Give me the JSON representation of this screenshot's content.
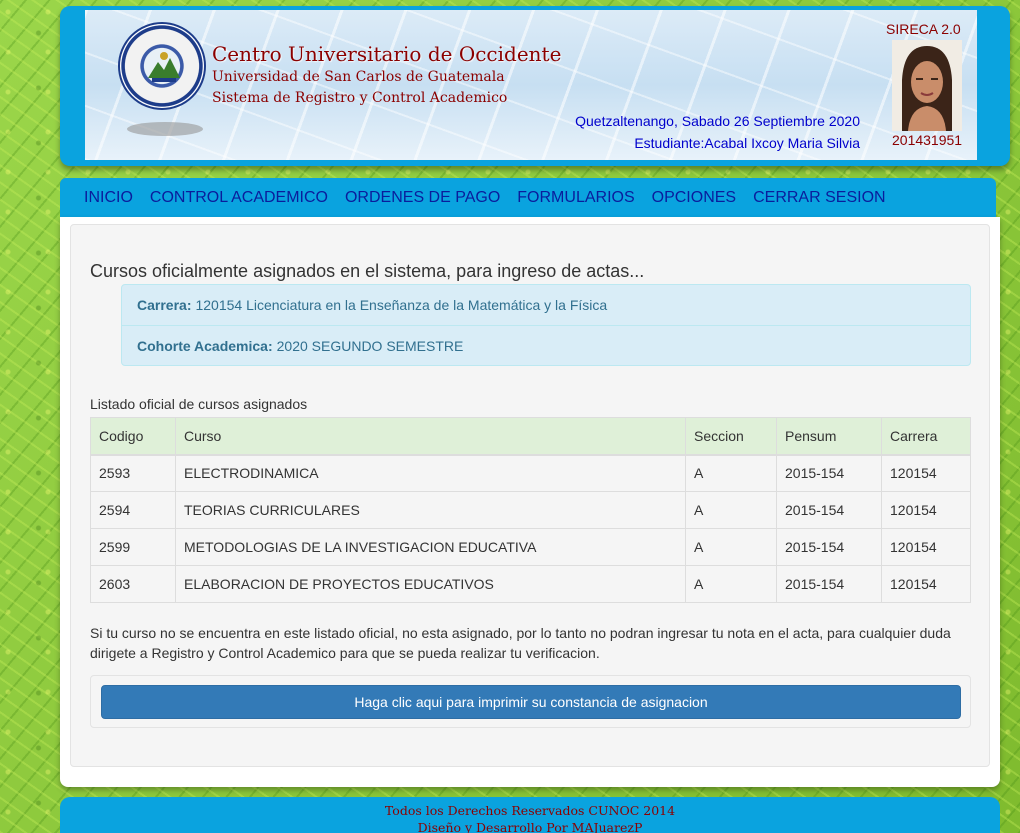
{
  "header": {
    "institution": "Centro Universitario de Occidente",
    "university": "Universidad de San Carlos de Guatemala",
    "system": "Sistema de Registro y Control Academico",
    "date_line": "Quetzaltenango, Sabado 26 Septiembre 2020",
    "student_line": "Estudiante:Acabal Ixcoy Maria Silvia",
    "app_name": "SIRECA 2.0",
    "student_id": "201431951"
  },
  "nav": {
    "items": [
      {
        "label": "INICIO"
      },
      {
        "label": "CONTROL ACADEMICO"
      },
      {
        "label": "ORDENES DE PAGO"
      },
      {
        "label": "FORMULARIOS"
      },
      {
        "label": "OPCIONES"
      },
      {
        "label": "CERRAR SESION"
      }
    ]
  },
  "main": {
    "heading": "Cursos oficialmente asignados en el sistema, para ingreso de actas...",
    "info": {
      "carrera_label": "Carrera:",
      "carrera_value": "120154 Licenciatura en la Enseñanza de la Matemática y la Física",
      "cohorte_label": "Cohorte Academica:",
      "cohorte_value": "2020 SEGUNDO SEMESTRE"
    },
    "list_caption": "Listado oficial de cursos asignados",
    "table": {
      "headers": [
        "Codigo",
        "Curso",
        "Seccion",
        "Pensum",
        "Carrera"
      ],
      "rows": [
        [
          "2593",
          "ELECTRODINAMICA",
          "A",
          "2015-154",
          "120154"
        ],
        [
          "2594",
          "TEORIAS CURRICULARES",
          "A",
          "2015-154",
          "120154"
        ],
        [
          "2599",
          "METODOLOGIAS DE LA INVESTIGACION EDUCATIVA",
          "A",
          "2015-154",
          "120154"
        ],
        [
          "2603",
          "ELABORACION DE PROYECTOS EDUCATIVOS",
          "A",
          "2015-154",
          "120154"
        ]
      ]
    },
    "note": "Si tu curso no se encuentra en este listado oficial, no esta asignado, por lo tanto no podran ingresar tu nota en el acta, para cualquier duda dirigete a Registro y Control Academico para que se pueda realizar tu verificacion.",
    "print_button": "Haga clic aqui para imprimir su constancia de asignacion"
  },
  "footer": {
    "line1": "Todos los Derechos Reservados CUNOC 2014",
    "line2": "Diseño y Desarrollo Por MAJuarezP"
  },
  "colors": {
    "header_blue": "#0aa3df",
    "nav_text": "#0a1d9c",
    "title_red": "#8b0000",
    "button_blue": "#337ab7",
    "table_header_green": "#dff0d8",
    "info_bg": "#d9edf7"
  }
}
